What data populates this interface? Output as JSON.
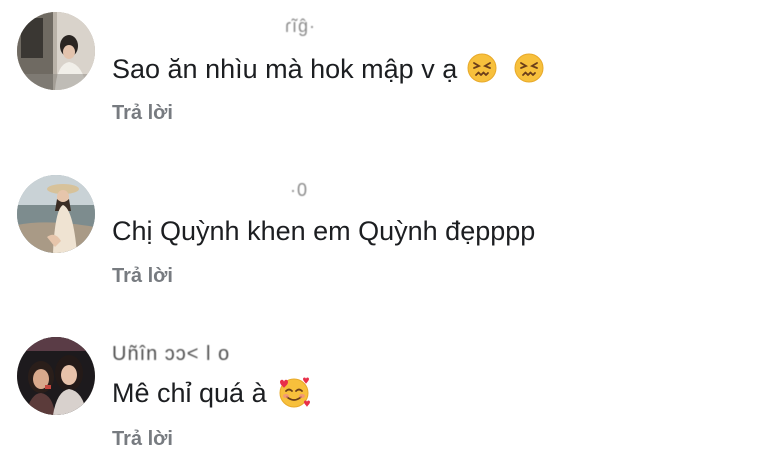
{
  "comments": [
    {
      "author": "ɾĩĝ·",
      "text": "Sao ăn nhìu mà hok mập v ạ",
      "emojis": [
        "confounded-face-emoji",
        "confounded-face-emoji"
      ],
      "reply_label": "Trả lời"
    },
    {
      "author": "·0",
      "text": "Chị Quỳnh khen em Quỳnh đẹpppp",
      "emojis": [],
      "reply_label": "Trả lời"
    },
    {
      "author": "Uñîn  ɔɔ< l o",
      "text": "Mê chỉ quá à",
      "emojis": [
        "smiling-face-with-hearts-emoji"
      ],
      "reply_label": "Trả lời"
    }
  ],
  "colors": {
    "reply_text": "#777b80",
    "comment_text": "#1c1e21",
    "emoji_yellow": "#f7c03c"
  }
}
